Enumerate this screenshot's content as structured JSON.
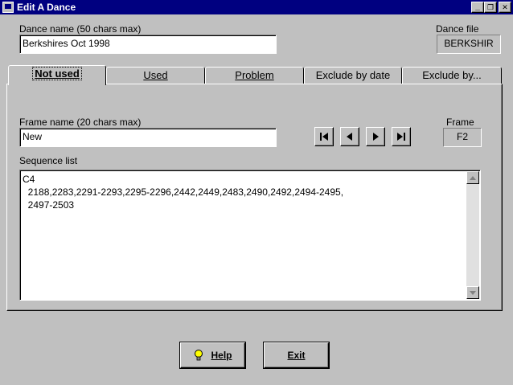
{
  "window": {
    "title": "Edit A Dance",
    "minimize_glyph": "_",
    "restore_glyph": "❐",
    "close_glyph": "✕"
  },
  "dance_name": {
    "label": "Dance name  (50 chars max)",
    "value": "Berkshires Oct 1998"
  },
  "dance_file": {
    "label": "Dance file",
    "value": "BERKSHIR"
  },
  "tabs": [
    {
      "label": "Not used",
      "active": true
    },
    {
      "label": "Used",
      "active": false
    },
    {
      "label": "Problem",
      "active": false
    },
    {
      "label": "Exclude by date",
      "active": false
    },
    {
      "label": "Exclude by...",
      "active": false
    }
  ],
  "frame_name": {
    "label": "Frame name  (20 chars max)",
    "value": "New"
  },
  "frame": {
    "label": "Frame",
    "value": "F2"
  },
  "sequence": {
    "label": "Sequence list",
    "text": "C4\n  2188,2283,2291-2293,2295-2296,2442,2449,2483,2490,2492,2494-2495,\n  2497-2503"
  },
  "buttons": {
    "help": "Help",
    "exit": "Exit"
  },
  "icons": {
    "nav_first": "first-record-icon",
    "nav_prev": "previous-record-icon",
    "nav_next": "next-record-icon",
    "nav_last": "last-record-icon",
    "help": "lightbulb-icon"
  }
}
